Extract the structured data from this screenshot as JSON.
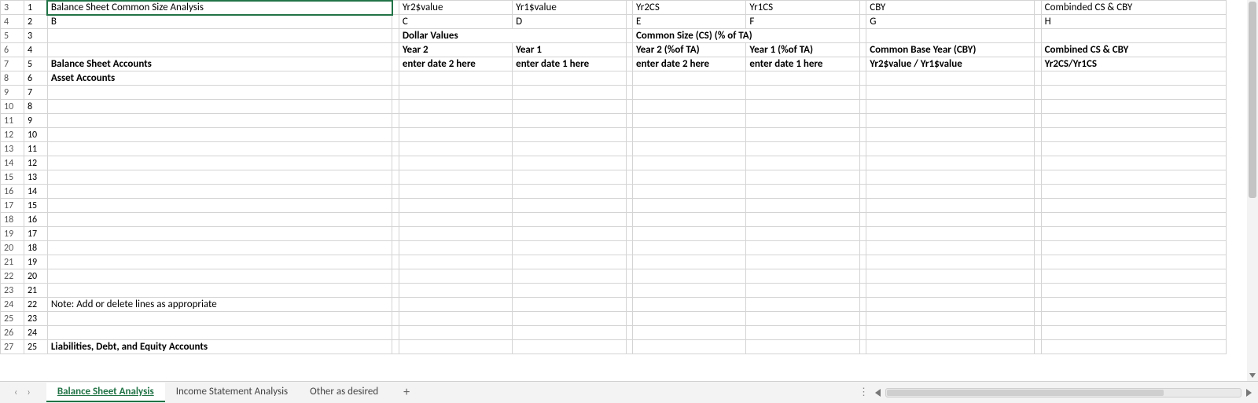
{
  "rows": [
    {
      "n": "3",
      "s": "1",
      "B": "Balance Sheet Common Size Analysis",
      "C": "Yr2$value",
      "D": "Yr1$value",
      "E": "Yr2CS",
      "F": "Yr1CS",
      "G": "CBY",
      "H": "Combinded CS & CBY",
      "sel": true,
      "hdrCenter": true
    },
    {
      "n": "4",
      "s": "2",
      "B": "B",
      "C": "C",
      "D": "D",
      "E": "E",
      "F": "F",
      "G": "G",
      "H": "H",
      "Bcenter": true,
      "hdrCenter": true
    },
    {
      "n": "5",
      "s": "3",
      "B": "",
      "CD": "Dollar Values",
      "EF": "Common Size (CS) (% of TA)",
      "G": "",
      "H": "",
      "ylwCD": true,
      "ylwEF": true
    },
    {
      "n": "6",
      "s": "4",
      "B": "",
      "C": "Year 2",
      "D": "Year 1",
      "E": "Year 2 (%of TA)",
      "F": "Year 1 (%of TA)",
      "G": "Common Base Year (CBY)",
      "H": "Combined CS & CBY",
      "ylw": true,
      "boldAll": true,
      "centerAll": true
    },
    {
      "n": "7",
      "s": "5",
      "B": "Balance Sheet Accounts",
      "C": "enter date 2 here",
      "D": "enter date 1 here",
      "E": "enter date 2 here",
      "F": "enter date 1 here",
      "G": "Yr2$value / Yr1$value",
      "H": "Yr2CS/Yr1CS",
      "Bbold": true,
      "Bcenter": true,
      "ylw": true,
      "boldData": true,
      "centerAll": true,
      "btop": true,
      "bbot": true
    },
    {
      "n": "8",
      "s": "6",
      "B": "Asset Accounts",
      "Bbold": true,
      "Bcenter": true
    },
    {
      "n": "9",
      "s": "7"
    },
    {
      "n": "10",
      "s": "8"
    },
    {
      "n": "11",
      "s": "9"
    },
    {
      "n": "12",
      "s": "10"
    },
    {
      "n": "13",
      "s": "11"
    },
    {
      "n": "14",
      "s": "12"
    },
    {
      "n": "15",
      "s": "13"
    },
    {
      "n": "16",
      "s": "14"
    },
    {
      "n": "17",
      "s": "15"
    },
    {
      "n": "18",
      "s": "16"
    },
    {
      "n": "19",
      "s": "17"
    },
    {
      "n": "20",
      "s": "18"
    },
    {
      "n": "21",
      "s": "19"
    },
    {
      "n": "22",
      "s": "20"
    },
    {
      "n": "23",
      "s": "21"
    },
    {
      "n": "24",
      "s": "22",
      "B": "Note: Add or delete lines as appropriate"
    },
    {
      "n": "25",
      "s": "23"
    },
    {
      "n": "26",
      "s": "24"
    },
    {
      "n": "27",
      "s": "25",
      "B": "Liabilities, Debt, and Equity Accounts",
      "Bbold": true,
      "Bcenter": true
    }
  ],
  "tabs": {
    "items": [
      "Balance Sheet Analysis",
      "Income Statement Analysis",
      "Other as desired"
    ],
    "activeIndex": 0
  }
}
